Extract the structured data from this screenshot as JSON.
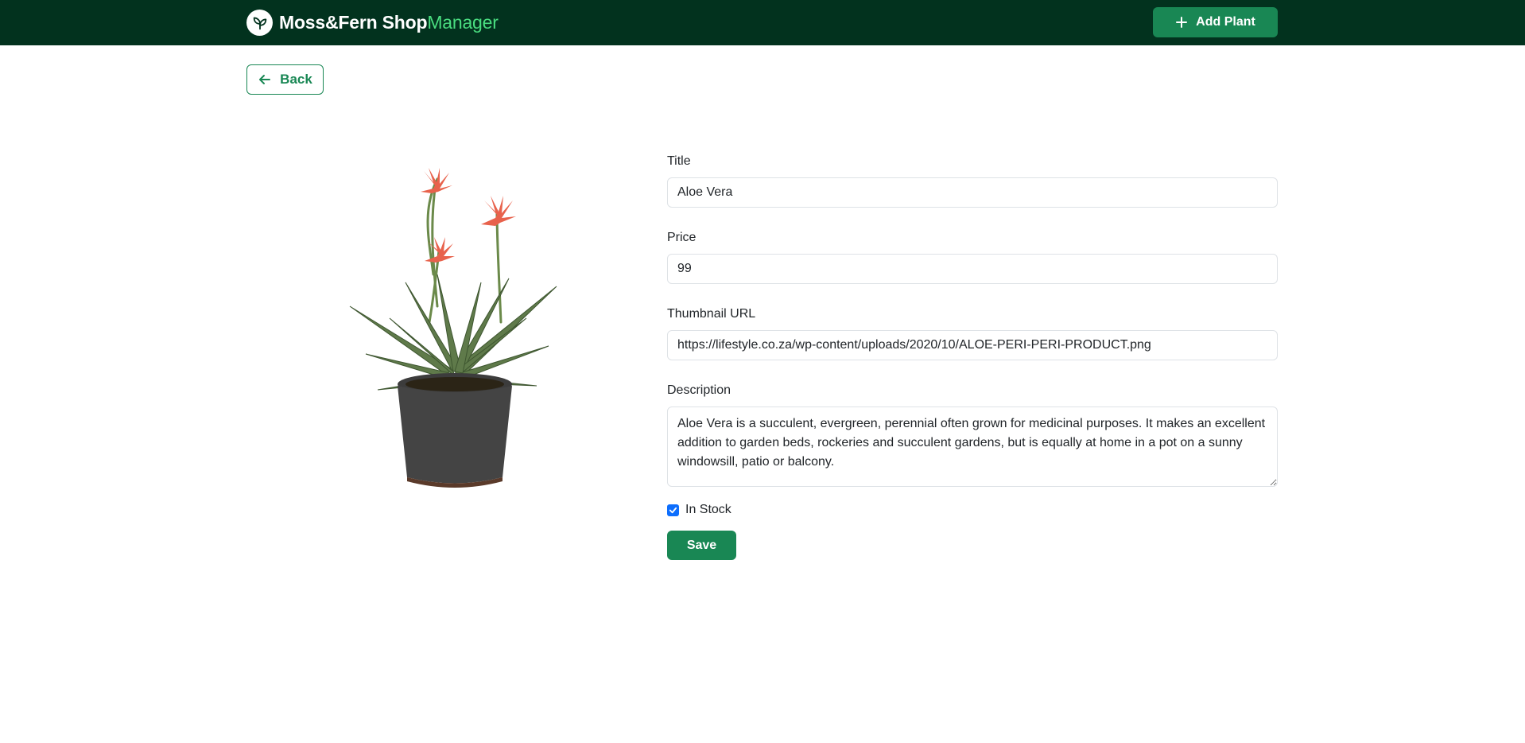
{
  "header": {
    "brand_name": "Moss&Fern Shop",
    "brand_accent": "Manager",
    "brand_icon": "leaf-icon",
    "add_button_label": "Add Plant",
    "add_button_icon": "plus-icon"
  },
  "nav": {
    "back_label": "Back",
    "back_icon": "arrow-left-icon"
  },
  "product_image": {
    "alt": "Aloe Vera"
  },
  "form": {
    "title_label": "Title",
    "title_value": "Aloe Vera",
    "price_label": "Price",
    "price_value": "99",
    "thumbnail_label": "Thumbnail URL",
    "thumbnail_value": "https://lifestyle.co.za/wp-content/uploads/2020/10/ALOE-PERI-PERI-PRODUCT.png",
    "description_label": "Description",
    "description_value": "Aloe Vera is a succulent, evergreen, perennial often grown for medicinal purposes. It makes an excellent addition to garden beds, rockeries and succulent gardens, but is equally at home in a pot on a sunny windowsill, patio or balcony.",
    "in_stock_label": "In Stock",
    "in_stock_checked": true,
    "save_label": "Save"
  },
  "colors": {
    "navbar": "#02321e",
    "brand_accent": "#4ade80",
    "primary_green": "#198754",
    "checkbox_blue": "#0d6efd"
  }
}
